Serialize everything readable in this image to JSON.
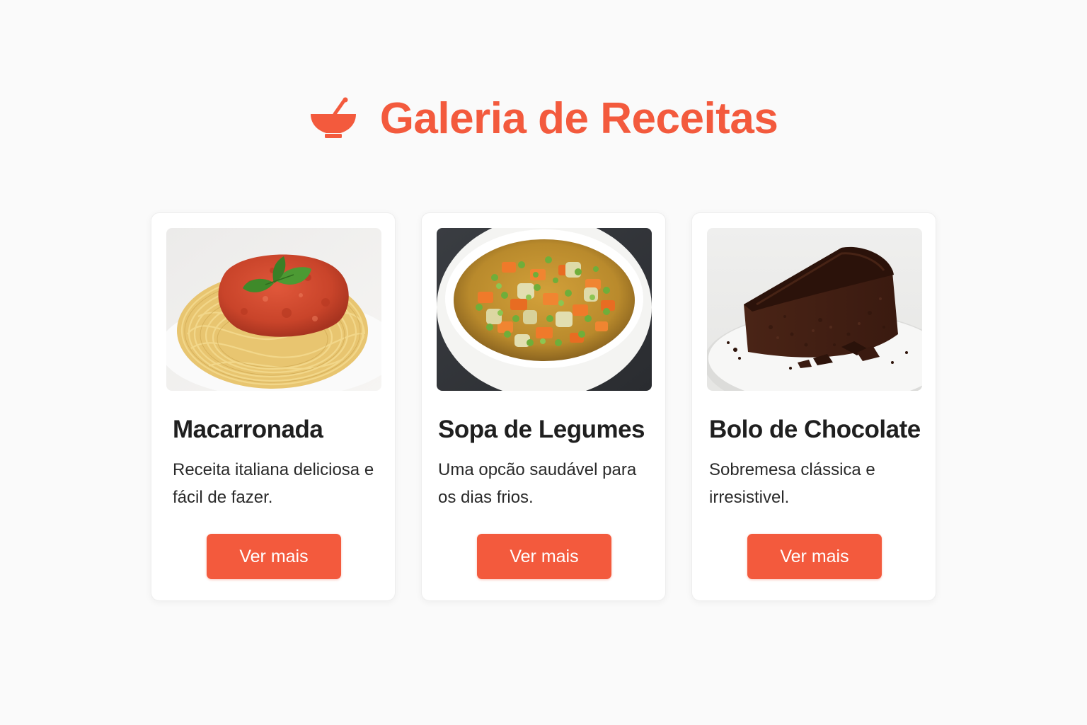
{
  "header": {
    "title": "Galeria de Receitas",
    "icon": "bowl-icon",
    "accent_color": "#f35a3d"
  },
  "recipes": [
    {
      "title": "Macarronada",
      "description": "Receita italiana deliciosa e fácil de fazer.",
      "button_label": "Ver mais",
      "image": "spaghetti-photo"
    },
    {
      "title": "Sopa de Legumes",
      "description": "Uma opcão saudável para os dias frios.",
      "button_label": "Ver mais",
      "image": "vegetable-soup-photo"
    },
    {
      "title": "Bolo de Chocolate",
      "description": "Sobremesa clássica e irresistivel.",
      "button_label": "Ver mais",
      "image": "chocolate-cake-photo"
    }
  ]
}
